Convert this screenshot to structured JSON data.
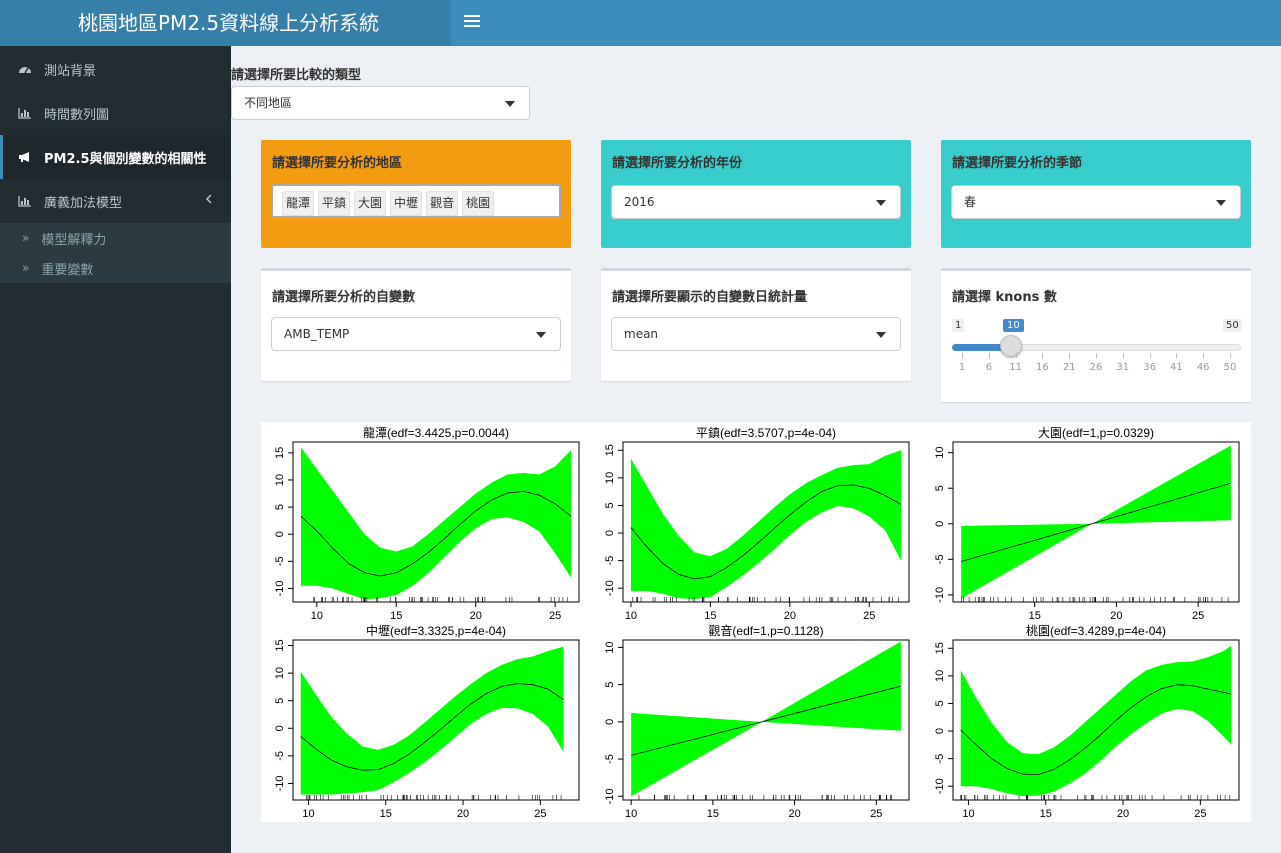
{
  "header": {
    "title": "桃園地區PM2.5資料線上分析系統"
  },
  "sidebar": {
    "items": [
      {
        "label": "測站背景",
        "icon": "dashboard-icon"
      },
      {
        "label": "時間數列圖",
        "icon": "bar-chart-icon"
      },
      {
        "label": "PM2.5與個別變數的相關性",
        "icon": "bullhorn-icon"
      },
      {
        "label": "廣義加法模型",
        "icon": "bar-chart-icon"
      }
    ],
    "subitems": [
      {
        "label": "模型解釋力"
      },
      {
        "label": "重要變數"
      }
    ]
  },
  "compare_type": {
    "label": "請選擇所要比較的類型",
    "value": "不同地區"
  },
  "region": {
    "label": "請選擇所要分析的地區",
    "tags": [
      "龍潭",
      "平鎮",
      "大園",
      "中壢",
      "觀音",
      "桃園"
    ]
  },
  "year": {
    "label": "請選擇所要分析的年份",
    "value": "2016"
  },
  "season": {
    "label": "請選擇所要分析的季節",
    "value": "春"
  },
  "variable": {
    "label": "請選擇所要分析的自變數",
    "value": "AMB_TEMP"
  },
  "statistic": {
    "label": "請選擇所要顯示的自變數日統計量",
    "value": "mean"
  },
  "knots": {
    "label": "請選擇 knons 數",
    "min": 1,
    "max": 50,
    "value": 10,
    "min_label": "1",
    "max_label": "50",
    "value_label": "10",
    "tick_labels": [
      "1",
      "6",
      "11",
      "16",
      "21",
      "26",
      "31",
      "36",
      "41",
      "46",
      "50"
    ]
  },
  "colors": {
    "band": "#00ff00",
    "accent": "#3c8dbc",
    "orange": "#f39c12",
    "aqua": "#39cccc"
  },
  "chart_data": [
    {
      "type": "area",
      "title": "龍潭(edf=3.4425,p=0.0044)",
      "x_ticks": [
        "10",
        "15",
        "20",
        "25"
      ],
      "y_ticks": [
        "-10",
        "-5",
        "0",
        "5",
        "10",
        "15"
      ],
      "xlim": [
        8.5,
        26.5
      ],
      "ylim": [
        -12.5,
        17
      ],
      "x": [
        9,
        10,
        11,
        12,
        13,
        14,
        15,
        16,
        17,
        18,
        19,
        20,
        21,
        22,
        23,
        24,
        25,
        26
      ],
      "fit": [
        3.3,
        0.6,
        -2.6,
        -5.4,
        -7.1,
        -7.7,
        -7.1,
        -5.5,
        -3.4,
        -0.9,
        1.8,
        4.3,
        6.3,
        7.6,
        7.9,
        7.2,
        5.6,
        3.3
      ],
      "upper": [
        16,
        12,
        8,
        4,
        0,
        -2.5,
        -3.2,
        -2.3,
        0,
        2.5,
        5,
        7.5,
        9.5,
        11,
        11.3,
        11,
        12.5,
        15.5
      ],
      "lower": [
        -9.5,
        -9.5,
        -10,
        -11,
        -12,
        -11.8,
        -11.2,
        -9.6,
        -7.2,
        -4.3,
        -1.4,
        1.1,
        2.8,
        3.1,
        2.3,
        0.5,
        -3.5,
        -8
      ]
    },
    {
      "type": "area",
      "title": "平鎮(edf=3.5707,p=4e-04)",
      "x_ticks": [
        "10",
        "15",
        "20",
        "25"
      ],
      "y_ticks": [
        "-10",
        "-5",
        "0",
        "5",
        "10",
        "15"
      ],
      "xlim": [
        9.5,
        27.5
      ],
      "ylim": [
        -12.5,
        16.5
      ],
      "x": [
        10,
        11,
        12,
        13,
        14,
        15,
        16,
        17,
        18,
        19,
        20,
        21,
        22,
        23,
        24,
        25,
        26,
        27
      ],
      "fit": [
        1,
        -2.5,
        -5.5,
        -7.5,
        -8.3,
        -7.9,
        -6.3,
        -4.2,
        -1.8,
        0.8,
        3.3,
        5.6,
        7.5,
        8.6,
        8.7,
        8.1,
        6.8,
        5.2
      ],
      "upper": [
        13.5,
        8.5,
        3.5,
        -0.5,
        -3.5,
        -4.2,
        -2.9,
        -0.6,
        2,
        4.6,
        7,
        9,
        10.5,
        11.8,
        12.3,
        12.5,
        14,
        15
      ],
      "lower": [
        -10.5,
        -10.5,
        -11,
        -11.8,
        -12,
        -11.6,
        -9.8,
        -7.8,
        -5.5,
        -3,
        -0.4,
        2,
        3.7,
        4.9,
        4.5,
        3,
        0.5,
        -5
      ]
    },
    {
      "type": "area",
      "title": "大園(edf=1,p=0.0329)",
      "x_ticks": [
        "15",
        "20",
        "25"
      ],
      "y_ticks": [
        "-10",
        "-5",
        "0",
        "5",
        "10"
      ],
      "xlim": [
        10,
        27.5
      ],
      "ylim": [
        -11,
        11.5
      ],
      "x": [
        10.5,
        18.5,
        27
      ],
      "fit": [
        -5.3,
        0,
        5.7
      ],
      "upper": [
        -0.3,
        0,
        11
      ],
      "lower": [
        -10.5,
        0,
        0.5
      ]
    },
    {
      "type": "area",
      "title": "中壢(edf=3.3325,p=4e-04)",
      "x_ticks": [
        "10",
        "15",
        "20",
        "25"
      ],
      "y_ticks": [
        "-10",
        "-5",
        "0",
        "5",
        "10",
        "15"
      ],
      "xlim": [
        9,
        27.5
      ],
      "ylim": [
        -13,
        16
      ],
      "x": [
        9.5,
        10.5,
        11.5,
        12.5,
        13.5,
        14.5,
        15.5,
        16.5,
        17.5,
        18.5,
        19.5,
        20.5,
        21.5,
        22.5,
        23.5,
        24.5,
        25.5,
        26.5
      ],
      "fit": [
        -1.5,
        -3.8,
        -5.8,
        -7,
        -7.6,
        -7.5,
        -6.4,
        -4.7,
        -2.6,
        -0.3,
        2.1,
        4.4,
        6.3,
        7.6,
        8.1,
        7.9,
        7.1,
        5.2
      ],
      "upper": [
        10.3,
        6,
        2,
        -1,
        -3.3,
        -3.9,
        -3,
        -1.3,
        1,
        3.4,
        5.8,
        8,
        10,
        11.5,
        12.5,
        13,
        14,
        14.8
      ],
      "lower": [
        -12,
        -12,
        -12,
        -11.8,
        -11.6,
        -11.2,
        -9.8,
        -8.1,
        -6.2,
        -4,
        -1.6,
        0.8,
        2.6,
        3.7,
        3.6,
        2.6,
        0.3,
        -4.3
      ]
    },
    {
      "type": "area",
      "title": "觀音(edf=1,p=0.1128)",
      "x_ticks": [
        "10",
        "15",
        "20",
        "25"
      ],
      "y_ticks": [
        "-10",
        "-5",
        "0",
        "5",
        "10"
      ],
      "xlim": [
        9.5,
        27
      ],
      "ylim": [
        -10.5,
        11
      ],
      "x": [
        10,
        18,
        26.5
      ],
      "fit": [
        -4.5,
        0,
        4.8
      ],
      "upper": [
        1.2,
        0,
        10.8
      ],
      "lower": [
        -10,
        0,
        -1.2
      ]
    },
    {
      "type": "area",
      "title": "桃園(edf=3.4289,p=4e-04)",
      "x_ticks": [
        "10",
        "15",
        "20",
        "25"
      ],
      "y_ticks": [
        "-10",
        "-5",
        "0",
        "5",
        "10",
        "15"
      ],
      "xlim": [
        9,
        27.5
      ],
      "ylim": [
        -12.5,
        16.5
      ],
      "x": [
        9.5,
        10.5,
        11.5,
        12.5,
        13.5,
        14.5,
        15.5,
        16.5,
        17.5,
        18.5,
        19.5,
        20.5,
        21.5,
        22.5,
        23.5,
        24.5,
        25.5,
        26.5,
        27
      ],
      "fit": [
        0.2,
        -2.5,
        -5,
        -6.8,
        -7.8,
        -7.9,
        -7,
        -5.3,
        -3.2,
        -0.8,
        1.8,
        4.2,
        6.2,
        7.7,
        8.4,
        8.2,
        7.6,
        7,
        6.7
      ],
      "upper": [
        11,
        6,
        1.5,
        -2,
        -4,
        -4.2,
        -3,
        -1,
        1.5,
        4,
        6.5,
        9,
        11,
        12,
        12.5,
        12.6,
        13.4,
        14.5,
        15.5
      ],
      "lower": [
        -10,
        -10,
        -10.5,
        -11.3,
        -11.8,
        -11.7,
        -11,
        -9.6,
        -7.8,
        -5.5,
        -2.9,
        -0.6,
        1.4,
        3.2,
        4,
        3.6,
        1.8,
        -1,
        -2.5
      ]
    }
  ]
}
